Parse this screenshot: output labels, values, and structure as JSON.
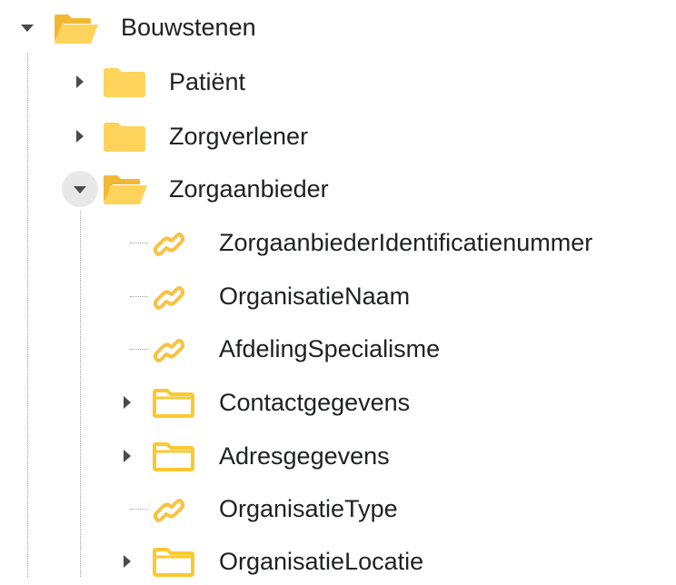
{
  "tree": {
    "root": {
      "label": "Bouwstenen",
      "expanded": true,
      "icon": "folder-open-icon",
      "children": [
        {
          "label": "Patiënt",
          "expanded": false,
          "icon": "folder-icon"
        },
        {
          "label": "Zorgverlener",
          "expanded": false,
          "icon": "folder-icon"
        },
        {
          "label": "Zorgaanbieder",
          "expanded": true,
          "icon": "folder-open-icon",
          "children": [
            {
              "label": "ZorgaanbiederIdentificatienummer",
              "icon": "link-icon"
            },
            {
              "label": "OrganisatieNaam",
              "icon": "link-icon"
            },
            {
              "label": "AfdelingSpecialisme",
              "icon": "link-icon"
            },
            {
              "label": "Contactgegevens",
              "expanded": false,
              "icon": "folder-outline-icon"
            },
            {
              "label": "Adresgegevens",
              "expanded": false,
              "icon": "folder-outline-icon"
            },
            {
              "label": "OrganisatieType",
              "icon": "link-icon"
            },
            {
              "label": "OrganisatieLocatie",
              "expanded": false,
              "icon": "folder-outline-icon"
            }
          ]
        }
      ]
    }
  },
  "colors": {
    "folder": "#fdd35c",
    "folder_outline": "#fbc82f",
    "link": "#f6c343",
    "toggle_arrow": "#4a4a4a",
    "toggle_hover_bg": "#e8e8e8",
    "guide_line": "#9e9e9e",
    "text": "#202124"
  }
}
